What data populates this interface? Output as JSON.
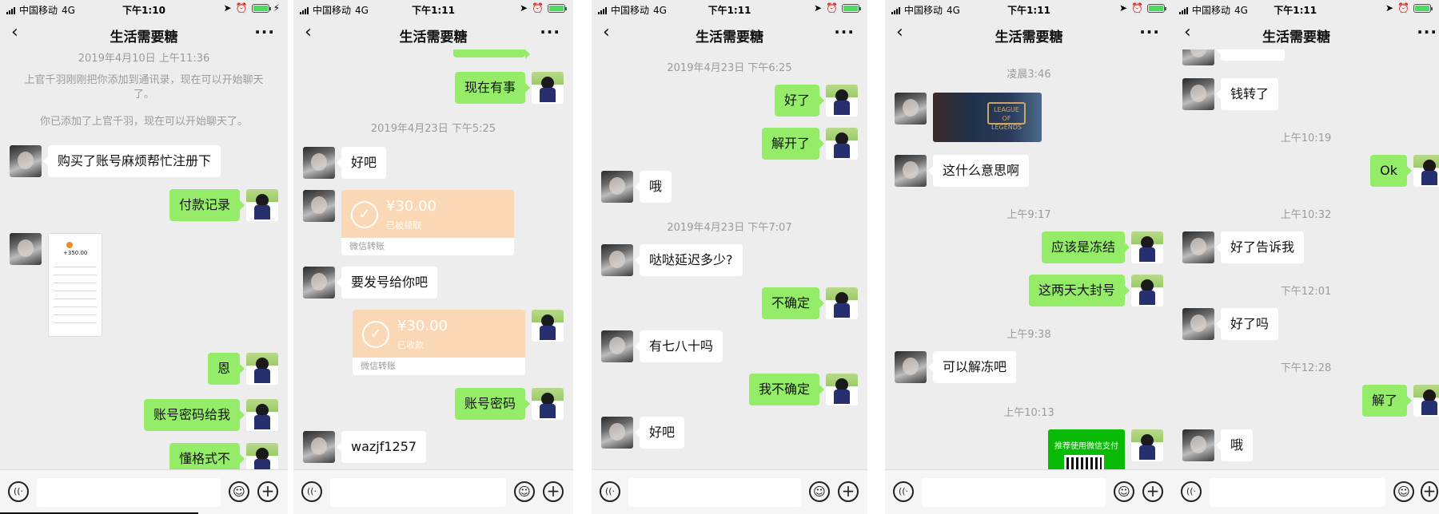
{
  "status": {
    "carrier": "中国移动",
    "network": "4G"
  },
  "chat_title": "生活需要糖",
  "nav": {
    "back": "‹",
    "more": "···"
  },
  "screens": [
    {
      "time": "下午1:10",
      "items": {
        "ts1": "2019年4月10日 上午11:36",
        "sys1": "上官千羽刚刚把你添加到通讯录，现在可以开始聊天了。",
        "sys2": "你已添加了上官千羽，现在可以开始聊天了。",
        "m1": "购买了账号麻烦帮忙注册下",
        "m2": "付款记录",
        "receipt_amount": "+350.00",
        "m3": "恩",
        "m4": "账号密码给我",
        "m5": "懂格式不"
      }
    },
    {
      "time": "下午1:11",
      "items": {
        "m1": "现在有事",
        "ts1": "2019年4月23日 下午5:25",
        "m2": "好吧",
        "t1_amount": "¥30.00",
        "t1_status": "已被领取",
        "t1_label": "微信转账",
        "m3": "要发号给你吧",
        "t2_amount": "¥30.00",
        "t2_status": "已收款",
        "t2_label": "微信转账",
        "m4": "账号密码",
        "m5": "wazjf1257"
      }
    },
    {
      "time": "下午1:11",
      "items": {
        "ts1": "2019年4月23日 下午6:25",
        "m1": "好了",
        "m2": "解开了",
        "m3": "哦",
        "ts2": "2019年4月23日 下午7:07",
        "m4": "哒哒延迟多少?",
        "m5": "不确定",
        "m6": "有七八十吗",
        "m7": "我不确定",
        "m8": "好吧"
      }
    },
    {
      "time": "下午1:11",
      "items": {
        "ts1": "凌晨3:46",
        "img_text": "LEAGUE OF LEGENDS",
        "m1": "这什么意思啊",
        "ts2": "上午9:17",
        "m2": "应该是冻结",
        "m3": "这两天大封号",
        "ts3": "上午9:38",
        "m4": "可以解冻吧",
        "ts4": "上午10:13",
        "pay_text": "推荐使用微信支付"
      }
    },
    {
      "time": "下午1:11",
      "items": {
        "m1": "钱转了",
        "ts1": "上午10:19",
        "m2": "Ok",
        "ts2": "上午10:32",
        "m3": "好了告诉我",
        "ts3": "下午12:01",
        "m4": "好了吗",
        "ts4": "下午12:28",
        "m5": "解了",
        "m6": "哦"
      }
    }
  ],
  "input": {
    "voice_icon": "((·",
    "emoji_icon": "☺",
    "plus_icon": "+"
  }
}
